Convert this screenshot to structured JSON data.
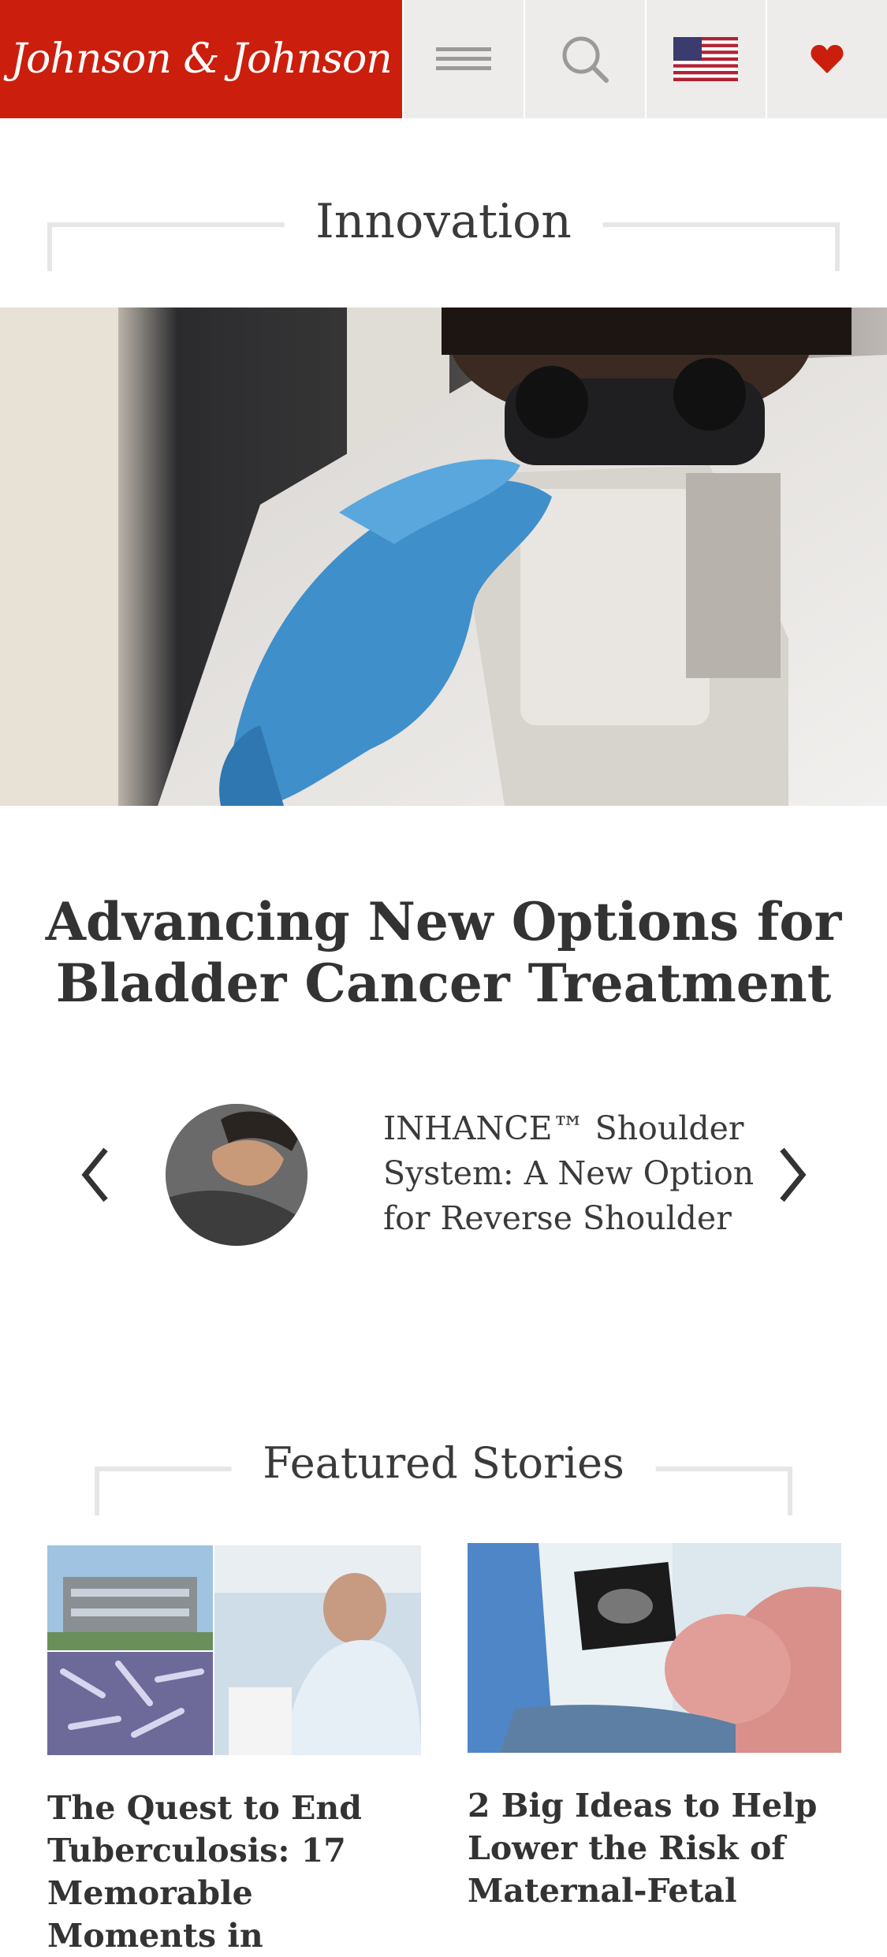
{
  "header": {
    "logo_text": "Johnson & Johnson",
    "menu_icon": "hamburger-menu-icon",
    "search_icon": "search-icon",
    "flag_icon": "us-flag-icon",
    "heart_icon": "heart-icon",
    "brand_color": "#cc1e0c",
    "bar_color": "#eeeceb"
  },
  "section1": {
    "title": "Innovation"
  },
  "hero": {
    "image_label": "Scientist using microscope"
  },
  "headline": "Advancing New Options for Bladder Cancer Treatment",
  "carousel": {
    "prev_icon": "chevron-left-icon",
    "next_icon": "chevron-right-icon",
    "item_title": "INHANCE™ Shoulder System: A New Option for Reverse Shoulder"
  },
  "section2": {
    "title": "Featured Stories"
  },
  "stories": [
    {
      "title": "The Quest to End Tuberculosis: 17 Memorable Moments in"
    },
    {
      "title": "2 Big Ideas to Help Lower the Risk of Maternal-Fetal"
    }
  ]
}
